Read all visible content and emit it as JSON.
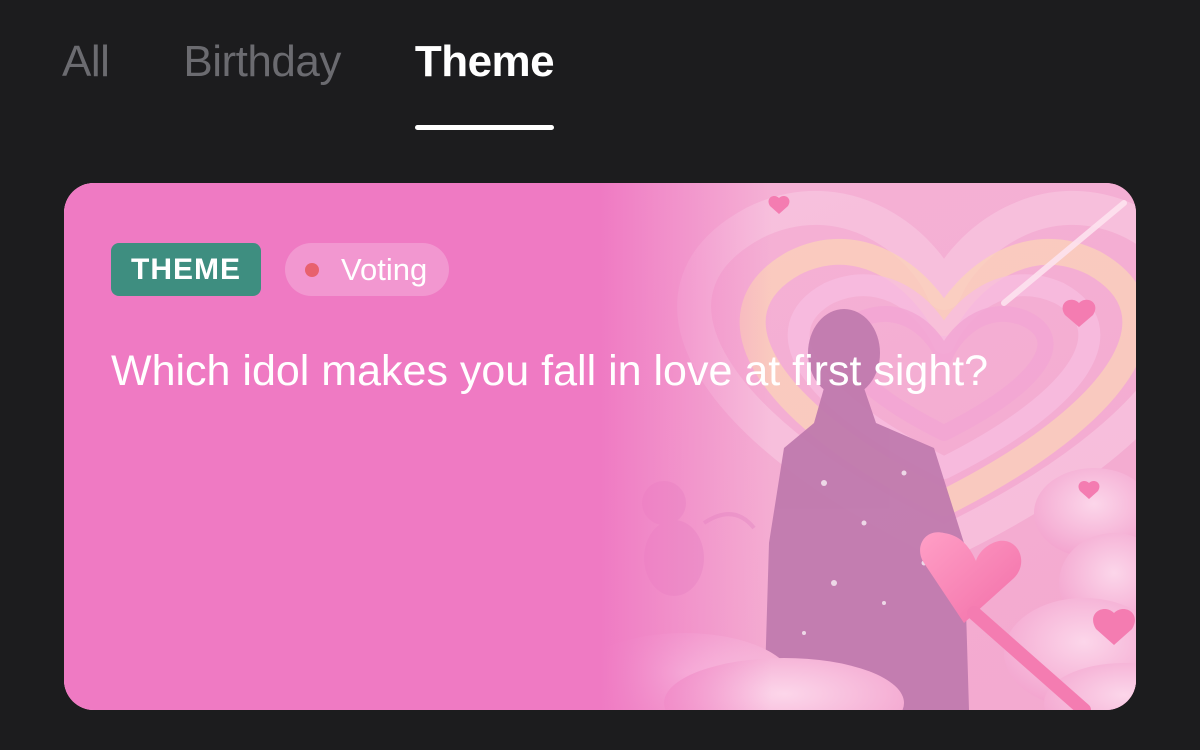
{
  "tabs": {
    "items": [
      {
        "label": "All",
        "active": false
      },
      {
        "label": "Birthday",
        "active": false
      },
      {
        "label": "Theme",
        "active": true
      }
    ]
  },
  "card": {
    "category_badge": "THEME",
    "status_label": "Voting",
    "question": "Which idol makes you fall in love at first sight?",
    "image_icon": "heart-illustration"
  },
  "colors": {
    "background": "#1c1c1e",
    "tab_inactive": "#6b6b70",
    "tab_active": "#ffffff",
    "card_pink": "#ef7ac3",
    "theme_badge": "#3e8e80",
    "status_dot": "#e8616e"
  }
}
